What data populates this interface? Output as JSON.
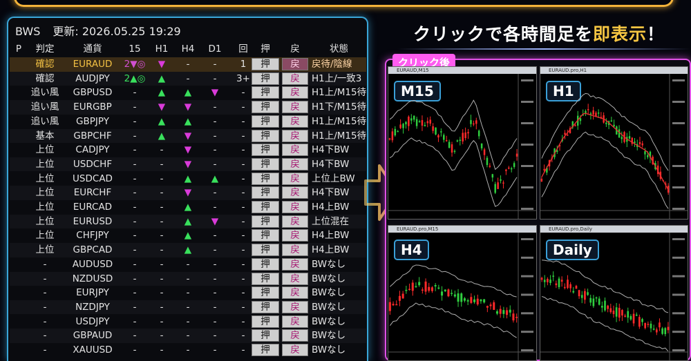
{
  "panel": {
    "title": "BWS",
    "updated_label": "更新: 2026.05.25 19:29"
  },
  "table": {
    "headers": [
      "P",
      "判定",
      "通貨",
      "15",
      "H1",
      "H4",
      "D1",
      "回",
      "押",
      "戻",
      "状態"
    ],
    "rows": [
      {
        "judge": "確認",
        "pair": "EURAUD",
        "m15": "2▼◎",
        "h1": "▼",
        "h4": "-",
        "d1": "-",
        "rep": "1",
        "push": "押",
        "back": "戻",
        "state": "戻待/陰線",
        "highlight": true
      },
      {
        "judge": "確認",
        "pair": "AUDJPY",
        "m15": "2▲◎",
        "h1": "▲",
        "h4": "-",
        "d1": "-",
        "rep": "3+",
        "push": "押",
        "back": "戻",
        "state": "H1上/一致3",
        "highlight": false
      },
      {
        "judge": "追い風",
        "pair": "GBPUSD",
        "m15": "-",
        "h1": "▲",
        "h4": "▲",
        "d1": "▼",
        "rep": "-",
        "push": "押",
        "back": "戻",
        "state": "H1上/M15待",
        "highlight": false
      },
      {
        "judge": "追い風",
        "pair": "EURGBP",
        "m15": "-",
        "h1": "▼",
        "h4": "▼",
        "d1": "-",
        "rep": "-",
        "push": "押",
        "back": "戻",
        "state": "H1下/M15待",
        "highlight": false
      },
      {
        "judge": "追い風",
        "pair": "GBPJPY",
        "m15": "-",
        "h1": "▲",
        "h4": "▲",
        "d1": "-",
        "rep": "-",
        "push": "押",
        "back": "戻",
        "state": "H1上/M15待",
        "highlight": false
      },
      {
        "judge": "基本",
        "pair": "GBPCHF",
        "m15": "-",
        "h1": "▲",
        "h4": "▼",
        "d1": "-",
        "rep": "-",
        "push": "押",
        "back": "戻",
        "state": "H1上/M15待",
        "highlight": false
      },
      {
        "judge": "上位",
        "pair": "CADJPY",
        "m15": "-",
        "h1": "-",
        "h4": "▼",
        "d1": "-",
        "rep": "-",
        "push": "押",
        "back": "戻",
        "state": "H4下BW",
        "highlight": false
      },
      {
        "judge": "上位",
        "pair": "USDCHF",
        "m15": "-",
        "h1": "-",
        "h4": "▼",
        "d1": "-",
        "rep": "-",
        "push": "押",
        "back": "戻",
        "state": "H4下BW",
        "highlight": false
      },
      {
        "judge": "上位",
        "pair": "USDCAD",
        "m15": "-",
        "h1": "-",
        "h4": "▲",
        "d1": "▲",
        "rep": "-",
        "push": "押",
        "back": "戻",
        "state": "上位上BW",
        "highlight": false
      },
      {
        "judge": "上位",
        "pair": "EURCHF",
        "m15": "-",
        "h1": "-",
        "h4": "▼",
        "d1": "-",
        "rep": "-",
        "push": "押",
        "back": "戻",
        "state": "H4下BW",
        "highlight": false
      },
      {
        "judge": "上位",
        "pair": "EURCAD",
        "m15": "-",
        "h1": "-",
        "h4": "▲",
        "d1": "-",
        "rep": "-",
        "push": "押",
        "back": "戻",
        "state": "H4上BW",
        "highlight": false
      },
      {
        "judge": "上位",
        "pair": "EURUSD",
        "m15": "-",
        "h1": "-",
        "h4": "▲",
        "d1": "▼",
        "rep": "-",
        "push": "押",
        "back": "戻",
        "state": "上位混在",
        "highlight": false
      },
      {
        "judge": "上位",
        "pair": "CHFJPY",
        "m15": "-",
        "h1": "-",
        "h4": "▲",
        "d1": "-",
        "rep": "-",
        "push": "押",
        "back": "戻",
        "state": "H4上BW",
        "highlight": false
      },
      {
        "judge": "上位",
        "pair": "GBPCAD",
        "m15": "-",
        "h1": "-",
        "h4": "▲",
        "d1": "-",
        "rep": "-",
        "push": "押",
        "back": "戻",
        "state": "H4上BW",
        "highlight": false
      },
      {
        "judge": "-",
        "pair": "AUDUSD",
        "m15": "-",
        "h1": "-",
        "h4": "-",
        "d1": "-",
        "rep": "-",
        "push": "押",
        "back": "戻",
        "state": "BWなし",
        "highlight": false
      },
      {
        "judge": "-",
        "pair": "NZDUSD",
        "m15": "-",
        "h1": "-",
        "h4": "-",
        "d1": "-",
        "rep": "-",
        "push": "押",
        "back": "戻",
        "state": "BWなし",
        "highlight": false
      },
      {
        "judge": "-",
        "pair": "EURJPY",
        "m15": "-",
        "h1": "-",
        "h4": "-",
        "d1": "-",
        "rep": "-",
        "push": "押",
        "back": "戻",
        "state": "BWなし",
        "highlight": false
      },
      {
        "judge": "-",
        "pair": "NZDJPY",
        "m15": "-",
        "h1": "-",
        "h4": "-",
        "d1": "-",
        "rep": "-",
        "push": "押",
        "back": "戻",
        "state": "BWなし",
        "highlight": false
      },
      {
        "judge": "-",
        "pair": "USDJPY",
        "m15": "-",
        "h1": "-",
        "h4": "-",
        "d1": "-",
        "rep": "-",
        "push": "押",
        "back": "戻",
        "state": "BWなし",
        "highlight": false
      },
      {
        "judge": "-",
        "pair": "GBPAUD",
        "m15": "-",
        "h1": "-",
        "h4": "-",
        "d1": "-",
        "rep": "-",
        "push": "押",
        "back": "戻",
        "state": "BWなし",
        "highlight": false
      },
      {
        "judge": "-",
        "pair": "XAUUSD",
        "m15": "-",
        "h1": "-",
        "h4": "-",
        "d1": "-",
        "rep": "-",
        "push": "押",
        "back": "戻",
        "state": "BWなし",
        "highlight": false
      }
    ]
  },
  "tagline": {
    "part1": "クリックで各時間足を",
    "part2": "即表示",
    "part3": "！"
  },
  "badge": "クリック後",
  "charts": [
    {
      "id": "m15",
      "title": "EURAUD,M15",
      "label": "M15"
    },
    {
      "id": "h1",
      "title": "EURAUD.pro,H1",
      "label": "H1"
    },
    {
      "id": "h4",
      "title": "EURAUD.pro,M15",
      "label": "H4"
    },
    {
      "id": "d1",
      "title": "EURAUD.pro,Daily",
      "label": "Daily"
    }
  ],
  "colors": {
    "panel_border": "#3aa6d8",
    "frame_border": "#e052e6",
    "up": "#39e05c",
    "down": "#d93bd9",
    "highlight_text": "#f2c043",
    "accent_gold": "#f5c542"
  }
}
